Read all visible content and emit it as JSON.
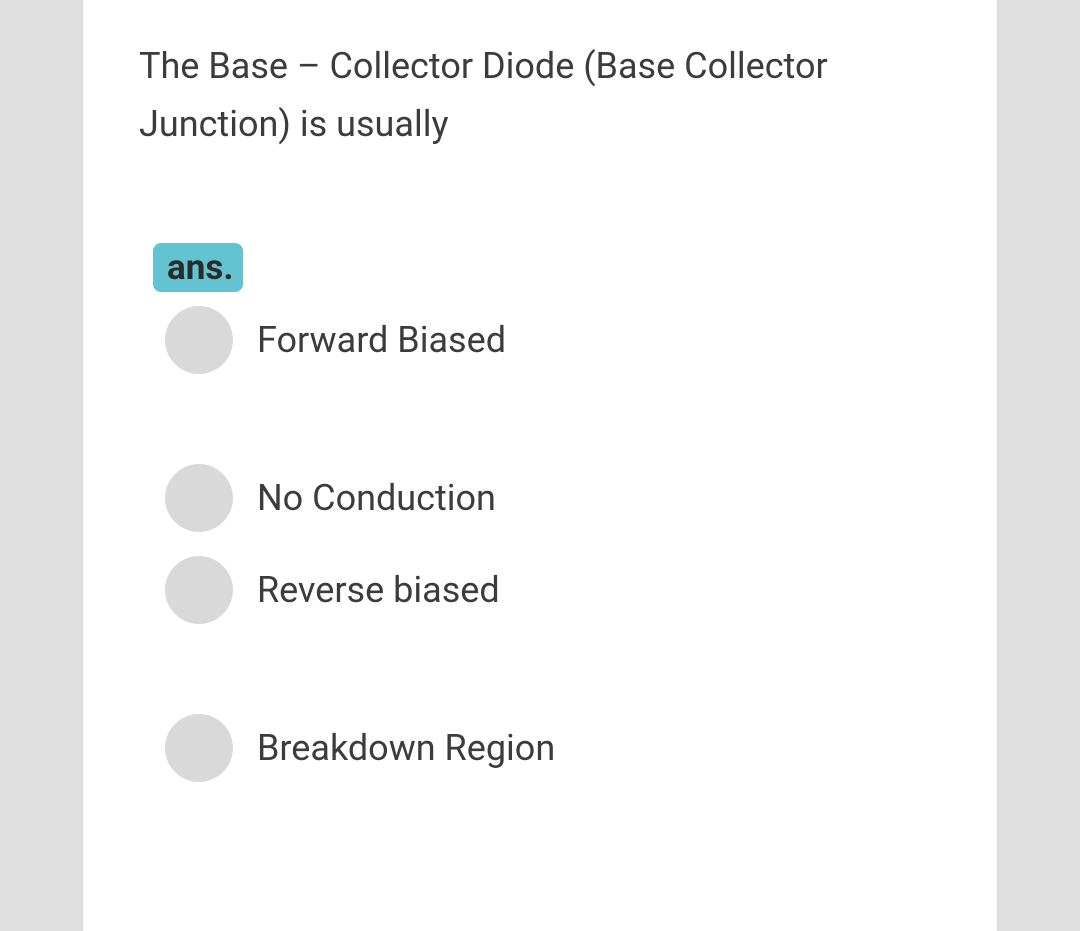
{
  "question": "The Base – Collector Diode (Base Collector Junction) is usually",
  "answerLabel": "ans.",
  "options": [
    {
      "text": "Forward Biased"
    },
    {
      "text": "No Conduction"
    },
    {
      "text": "Reverse biased"
    },
    {
      "text": "Breakdown Region"
    }
  ]
}
